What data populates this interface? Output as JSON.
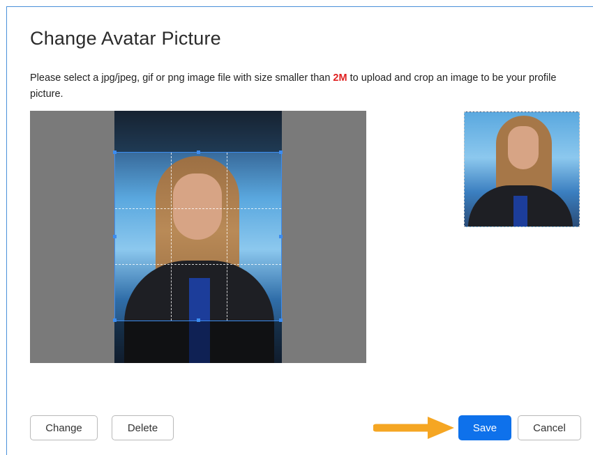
{
  "dialog": {
    "title": "Change Avatar Picture",
    "description_before": "Please select a jpg/jpeg, gif or png image file with size smaller than ",
    "description_highlight": "2M",
    "description_after": " to upload and crop an image to be your profile picture."
  },
  "buttons": {
    "change": "Change",
    "delete": "Delete",
    "save": "Save",
    "cancel": "Cancel"
  },
  "colors": {
    "accent": "#0e71eb",
    "highlight": "#e02020",
    "arrow": "#f5a623"
  }
}
